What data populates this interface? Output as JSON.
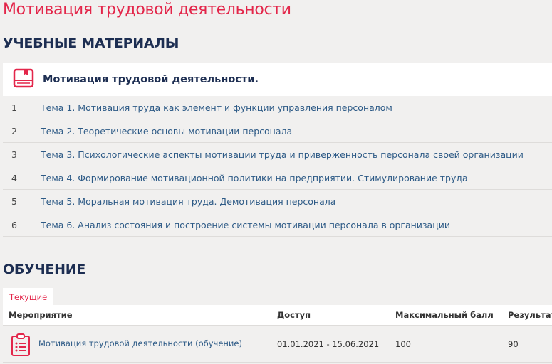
{
  "page_title": "Мотивация трудовой деятельности",
  "materials": {
    "heading": "УЧЕБНЫЕ МАТЕРИАЛЫ",
    "course_title": "Мотивация трудовой деятельности.",
    "icon": "book-icon",
    "topics": [
      {
        "n": "1",
        "label": "Тема 1. Мотивация труда как элемент и функции управления персоналом"
      },
      {
        "n": "2",
        "label": "Тема 2. Теоретические основы мотивации персонала"
      },
      {
        "n": "3",
        "label": "Тема 3. Психологические аспекты мотивации труда и приверженность персонала своей организации"
      },
      {
        "n": "4",
        "label": "Тема 4. Формирование мотивационной политики на предприятии. Стимулирование труда"
      },
      {
        "n": "5",
        "label": "Тема 5. Моральная мотивация труда. Демотивация персонала"
      },
      {
        "n": "6",
        "label": "Тема 6. Анализ состояния и построение системы мотивации персонала в организации"
      }
    ]
  },
  "training": {
    "heading": "ОБУЧЕНИЕ",
    "tab": "Текущие",
    "columns": [
      "Мероприятие",
      "Доступ",
      "Максимальный балл",
      "Результат"
    ],
    "rows": [
      {
        "event": "Мотивация трудовой деятельности (обучение)",
        "access": "01.01.2021 - 15.06.2021",
        "max": "100",
        "result": "90",
        "icon": "clipboard-list-icon"
      }
    ]
  },
  "colors": {
    "accent": "#e3264a",
    "heading": "#1d2e52",
    "link": "#2d5a86"
  }
}
